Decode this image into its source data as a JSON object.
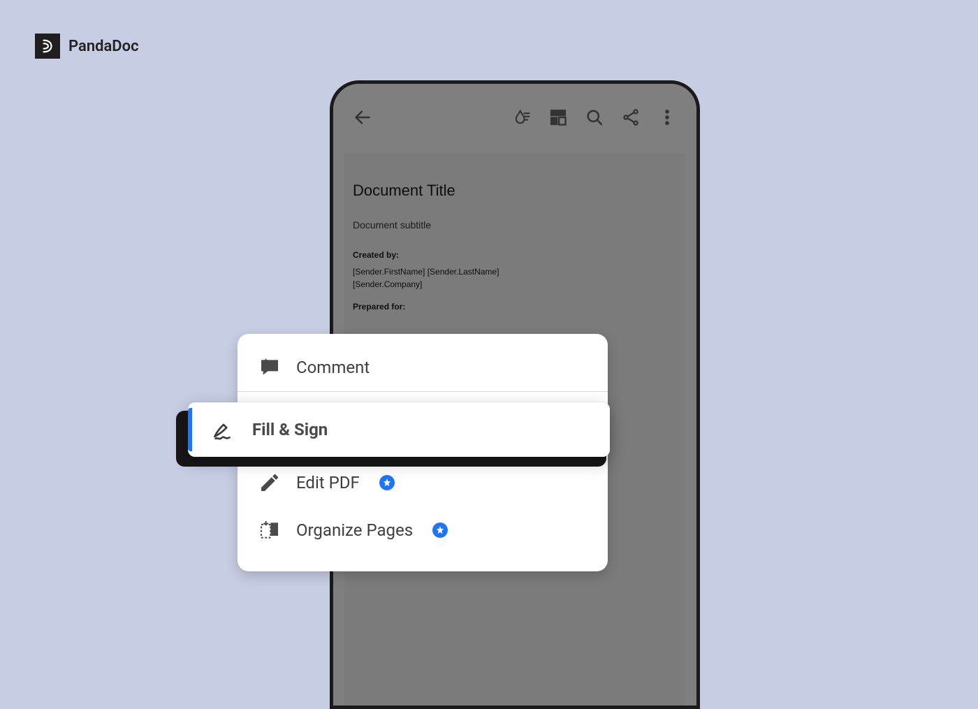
{
  "brand": {
    "name": "PandaDoc"
  },
  "phone": {
    "toolbar_icons": [
      "back",
      "ink",
      "layout",
      "search",
      "share",
      "more"
    ],
    "document": {
      "title": "Document Title",
      "subtitle": "Document subtitle",
      "created_label": "Created by:",
      "sender_line1": "[Sender.FirstName] [Sender.LastName]",
      "sender_line2": "[Sender.Company]",
      "prepared_label": "Prepared for:"
    }
  },
  "menu": {
    "items": [
      {
        "id": "comment",
        "label": "Comment",
        "icon": "comment-icon",
        "premium": false
      },
      {
        "id": "fillsign",
        "label": "Fill & Sign",
        "icon": "sign-icon",
        "premium": false,
        "highlighted": true
      },
      {
        "id": "editpdf",
        "label": "Edit PDF",
        "icon": "pencil-icon",
        "premium": true
      },
      {
        "id": "organize",
        "label": "Organize Pages",
        "icon": "organize-icon",
        "premium": true
      }
    ]
  }
}
